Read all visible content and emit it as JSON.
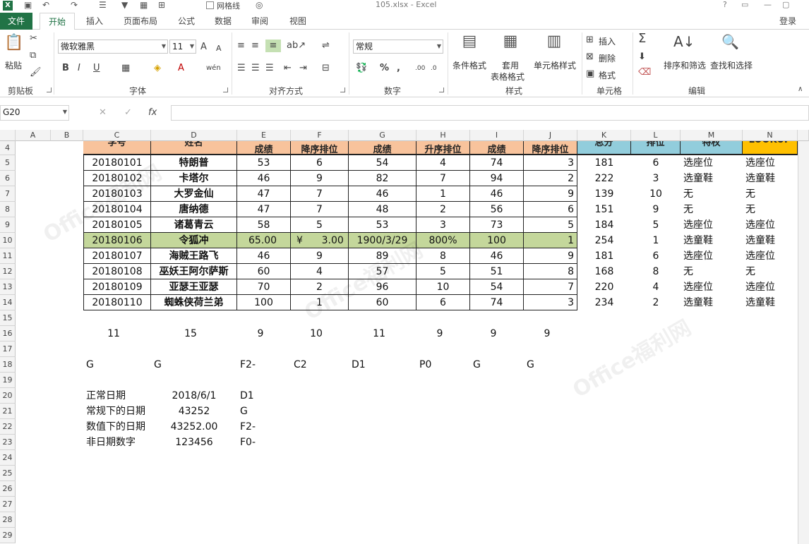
{
  "window": {
    "title": "105.xlsx - Excel",
    "quick_checkbox_label": "网格线",
    "help": "?"
  },
  "tabs": [
    {
      "label": "文件"
    },
    {
      "label": "开始"
    },
    {
      "label": "插入"
    },
    {
      "label": "页面布局"
    },
    {
      "label": "公式"
    },
    {
      "label": "数据"
    },
    {
      "label": "审阅"
    },
    {
      "label": "视图"
    }
  ],
  "login": "登录",
  "ribbon": {
    "paste": "粘贴",
    "font_name": "微软雅黑",
    "font_size": "11",
    "number_format": "常规",
    "conditional_format": "条件格式",
    "table_format_1": "套用",
    "table_format_2": "表格格式",
    "cell_style": "单元格样式",
    "insert": "插入",
    "delete": "删除",
    "format": "格式",
    "sort_filter": "排序和筛选",
    "find_select": "查找和选择",
    "groups": {
      "clipboard": "剪贴板",
      "font": "字体",
      "alignment": "对齐方式",
      "number": "数字",
      "styles": "样式",
      "cells": "单元格",
      "editing": "编辑"
    }
  },
  "formula_bar": {
    "name_box": "G20",
    "fx": "fx",
    "value": ""
  },
  "columns": [
    "A",
    "B",
    "C",
    "D",
    "E",
    "F",
    "G",
    "H",
    "I",
    "J",
    "K",
    "L",
    "M",
    "N"
  ],
  "rows": [
    "4",
    "5",
    "6",
    "7",
    "8",
    "9",
    "10",
    "11",
    "12",
    "13",
    "14",
    "15",
    "16",
    "17",
    "18",
    "19",
    "20",
    "21",
    "22",
    "23",
    "24",
    "25",
    "26",
    "27",
    "28",
    "29"
  ],
  "header_row": {
    "C": "学号",
    "D": "姓名",
    "E": "成绩",
    "F": "降序排位",
    "G": "成绩",
    "H": "升序排位",
    "I": "成绩",
    "J": "降序排位",
    "K": "总分",
    "L": "排位",
    "M": "特权",
    "N": "LOOKUP"
  },
  "table": [
    [
      "20180101",
      "特朗普",
      "53",
      "6",
      "54",
      "4",
      "74",
      "3",
      "181",
      "6",
      "选座位",
      "选座位"
    ],
    [
      "20180102",
      "卡塔尔",
      "46",
      "9",
      "82",
      "7",
      "94",
      "2",
      "222",
      "3",
      "选童鞋",
      "选童鞋"
    ],
    [
      "20180103",
      "大罗金仙",
      "47",
      "7",
      "46",
      "1",
      "46",
      "9",
      "139",
      "10",
      "无",
      "无"
    ],
    [
      "20180104",
      "唐纳德",
      "47",
      "7",
      "48",
      "2",
      "56",
      "6",
      "151",
      "9",
      "无",
      "无"
    ],
    [
      "20180105",
      "诸葛青云",
      "58",
      "5",
      "53",
      "3",
      "73",
      "5",
      "184",
      "5",
      "选座位",
      "选座位"
    ],
    [
      "20180106",
      "令狐冲",
      "65.00",
      "¥      3.00",
      "1900/3/29",
      "800%",
      "100",
      "1",
      "254",
      "1",
      "选童鞋",
      "选童鞋"
    ],
    [
      "20180107",
      "海贼王路飞",
      "46",
      "9",
      "89",
      "8",
      "46",
      "9",
      "181",
      "6",
      "选座位",
      "选座位"
    ],
    [
      "20180108",
      "巫妖王阿尔萨斯",
      "60",
      "4",
      "57",
      "5",
      "51",
      "8",
      "168",
      "8",
      "无",
      "无"
    ],
    [
      "20180109",
      "亚瑟王亚瑟",
      "70",
      "2",
      "96",
      "10",
      "54",
      "7",
      "220",
      "4",
      "选座位",
      "选座位"
    ],
    [
      "20180110",
      "蜘蛛侠荷兰弟",
      "100",
      "1",
      "60",
      "6",
      "74",
      "3",
      "234",
      "2",
      "选童鞋",
      "选童鞋"
    ]
  ],
  "row16": [
    "11",
    "15",
    "9",
    "10",
    "11",
    "9",
    "9",
    "9"
  ],
  "row18": [
    "G",
    "G",
    "F2-",
    "C2",
    "D1",
    "P0",
    "G",
    "G"
  ],
  "notes": [
    [
      "正常日期",
      "2018/6/1",
      "D1"
    ],
    [
      "常规下的日期",
      "43252",
      "G"
    ],
    [
      "数值下的日期",
      "43252.00",
      "F2-"
    ],
    [
      "非日期数字",
      "123456",
      "F0-"
    ]
  ],
  "watermark": "Office福利网",
  "colors": {
    "header_orange": "#f8c39c",
    "header_blue": "#92cddc",
    "header_gold": "#ffc000",
    "highlight_green": "#c4d79b",
    "excel_green": "#217346"
  }
}
